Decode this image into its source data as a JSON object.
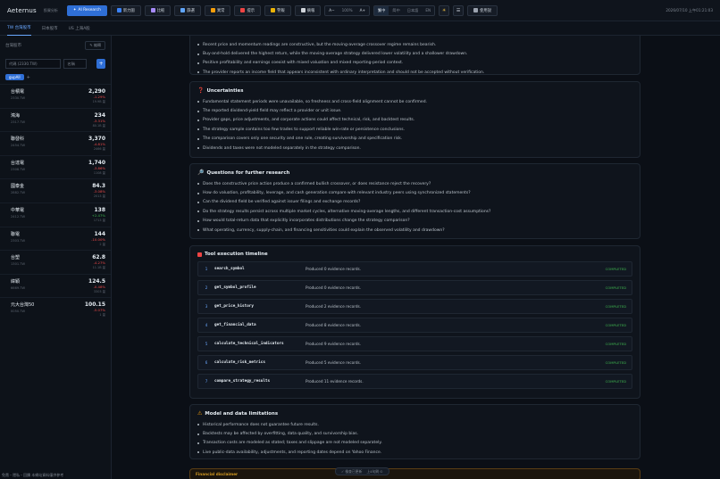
{
  "topbar": {
    "brand": "Aeternus",
    "brand_sub": "投資分析",
    "ai_research": "AI Research",
    "buttons": [
      "新力圖",
      "比較",
      "篩選",
      "異常",
      "提示",
      "警報",
      "摘報"
    ],
    "font_minus": "A−",
    "font_size": "100%",
    "font_plus": "A+",
    "lang": [
      "繁中",
      "简中",
      "日本語",
      "EN"
    ],
    "theme_icon": "☀",
    "bell_icon": "☰",
    "user": "使用說",
    "clock": "2026/07/10 上午01:21:03"
  },
  "subbar": {
    "tabs": [
      "TW 台灣股市",
      "日本股市",
      "US 上海A股"
    ]
  },
  "sidebar": {
    "title": "台灣股市",
    "edit": "✎ 編輯",
    "code_placeholder": "代碼 (2330.TW)",
    "name_placeholder": "名稱",
    "add": "+",
    "tag": "gupAll",
    "tag_plus": "+",
    "stocks": [
      {
        "name": "台積電",
        "code": "2330.TW",
        "price": "2,290",
        "chg": "-1.29%",
        "vol": "19.9B 量"
      },
      {
        "name": "鴻海",
        "code": "2317.TW",
        "price": "234",
        "chg": "-3.31%",
        "vol": "80.1B 量"
      },
      {
        "name": "聯發科",
        "code": "2454.TW",
        "price": "3,370",
        "chg": "-4.81%",
        "vol": "2466 量"
      },
      {
        "name": "台達電",
        "code": "2308.TW",
        "price": "1,740",
        "chg": "-3.86%",
        "vol": "1108 量"
      },
      {
        "name": "國泰金",
        "code": "2882.TW",
        "price": "84.3",
        "chg": "-3.08%",
        "vol": "2013 量"
      },
      {
        "name": "中華電",
        "code": "2412.TW",
        "price": "138",
        "chg": "+2.47%",
        "vol": "1713 量"
      },
      {
        "name": "聯電",
        "code": "2303.TW",
        "price": "144",
        "chg": "-10.00%",
        "vol": "2 量"
      },
      {
        "name": "台塑",
        "code": "1301.TW",
        "price": "62.8",
        "chg": "-4.27%",
        "vol": "11.1B 量"
      },
      {
        "name": "緯穎",
        "code": "6669.TW",
        "price": "124.5",
        "chg": "-0.48%",
        "vol": "3303 量"
      },
      {
        "name": "元大台灣50",
        "code": "0050.TW",
        "price": "100.15",
        "chg": "-5.07%",
        "vol": "1 量"
      }
    ]
  },
  "top_list": [
    "Recent price and momentum readings are constructive, but the moving-average crossover regime remains bearish.",
    "Buy-and-hold delivered the highest return, while the moving-average strategy delivered lower volatility and a shallower drawdown.",
    "Positive profitability and earnings coexist with mixed valuation and mixed reporting-period context.",
    "The provider reports an income field that appears inconsistent with ordinary interpretation and should not be accepted without verification."
  ],
  "uncertainties": {
    "title": "Uncertainties",
    "icon": "question-icon",
    "items": [
      "Fundamental statement periods were unavailable, so freshness and cross-field alignment cannot be confirmed.",
      "The reported dividend-yield field may reflect a provider or unit issue.",
      "Provider gaps, price adjustments, and corporate actions could affect technical, risk, and backtest results.",
      "The strategy sample contains too few trades to support reliable win-rate or persistence conclusions.",
      "The comparison covers only one security and one rule, creating survivorship and specification risk.",
      "Dividends and taxes were not modeled separately in the strategy comparison."
    ]
  },
  "questions": {
    "title": "Questions for further research",
    "icon": "search-icon",
    "items": [
      "Does the constructive price action produce a confirmed bullish crossover, or does resistance reject the recovery?",
      "How do valuation, profitability, leverage, and cash generation compare with relevant industry peers using synchronized statements?",
      "Can the dividend field be verified against issuer filings and exchange records?",
      "Do the strategy results persist across multiple market cycles, alternative moving-average lengths, and different transaction-cost assumptions?",
      "How would total-return data that explicitly incorporates distributions change the strategy comparison?",
      "What operating, currency, supply-chain, and financing sensitivities could explain the observed volatility and drawdown?"
    ]
  },
  "timeline": {
    "title": "Tool execution timeline",
    "icon": "toolbox-icon",
    "rows": [
      {
        "num": "1",
        "name": "search_symbol",
        "result": "Produced 0 evidence records.",
        "status": "COMPLETED"
      },
      {
        "num": "2",
        "name": "get_symbol_profile",
        "result": "Produced 0 evidence records.",
        "status": "COMPLETED"
      },
      {
        "num": "3",
        "name": "get_price_history",
        "result": "Produced 2 evidence records.",
        "status": "COMPLETED"
      },
      {
        "num": "4",
        "name": "get_financial_data",
        "result": "Produced 8 evidence records.",
        "status": "COMPLETED"
      },
      {
        "num": "5",
        "name": "calculate_technical_indicators",
        "result": "Produced 9 evidence records.",
        "status": "COMPLETED"
      },
      {
        "num": "6",
        "name": "calculate_risk_metrics",
        "result": "Produced 5 evidence records.",
        "status": "COMPLETED"
      },
      {
        "num": "7",
        "name": "compare_strategy_results",
        "result": "Produced 11 evidence records.",
        "status": "COMPLETED"
      }
    ]
  },
  "limitations": {
    "title": "Model and data limitations",
    "icon": "warning-icon",
    "items": [
      "Historical performance does not guarantee future results.",
      "Backtests may be affected by overfitting, data quality, and survivorship bias.",
      "Transaction costs are modeled as stated; taxes and slippage are not modeled separately.",
      "Live public-data availability, adjustments, and reporting dates depend on Yahoo Finance."
    ]
  },
  "disclaimer": {
    "title": "Financial disclaimer"
  },
  "bottom_bar": {
    "left": "✓ 檢查已更新",
    "right": "上4句刷 ⊙"
  },
  "status_line": "免責・隱私・回饋 本網站資料僅供參考"
}
